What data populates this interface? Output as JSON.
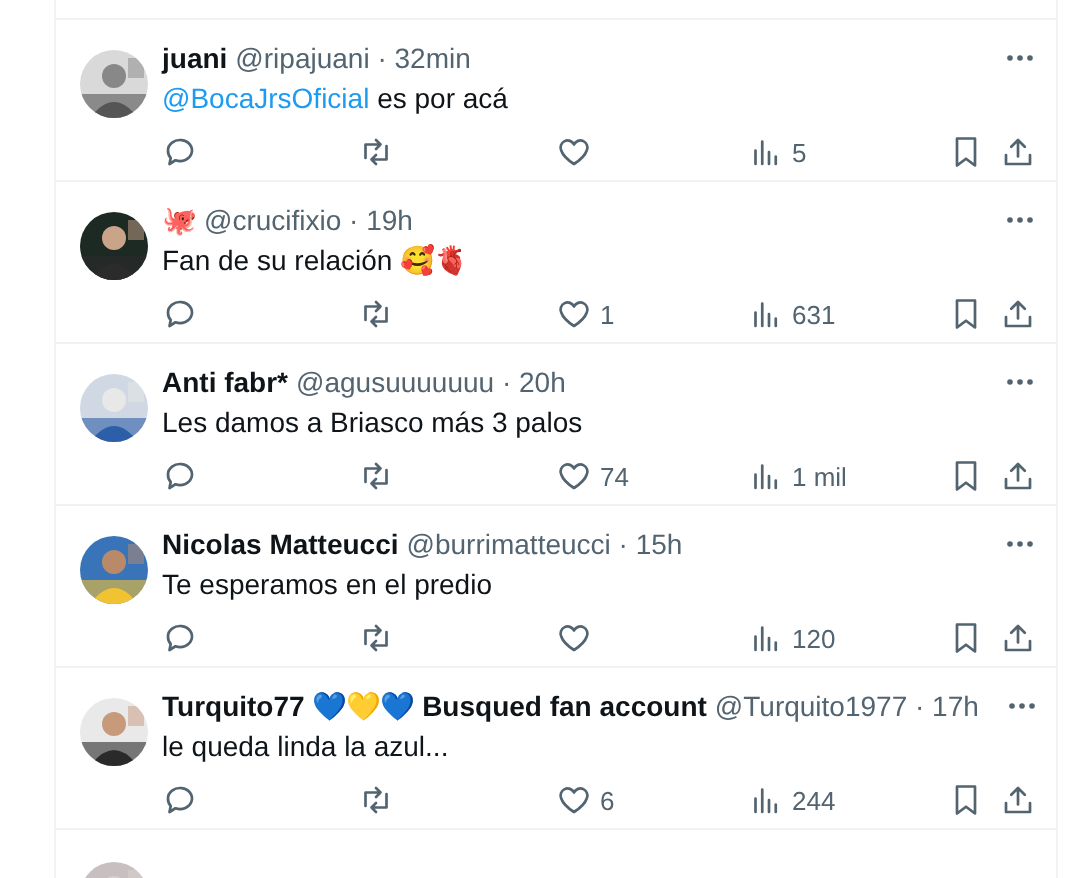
{
  "tweets": [
    {
      "name": "juani",
      "meta": "@ripajuani · 32min",
      "mention": "@BocaJrsOficial",
      "text": "es por acá",
      "stats": {
        "views": "5"
      }
    },
    {
      "name": "🐙",
      "meta": "@crucifixio · 19h",
      "text": "Fan de su relación 🥰🫀",
      "stats": {
        "likes": "1",
        "views": "631"
      }
    },
    {
      "name": "Anti fabr*",
      "meta": "@agusuuuuuuu · 20h",
      "text": "Les damos a Briasco más 3 palos",
      "stats": {
        "likes": "74",
        "views": "1 mil"
      }
    },
    {
      "name": "Nicolas Matteucci",
      "meta": "@burrimatteucci · 15h",
      "text": "Te esperamos en el predio",
      "stats": {
        "views": "120"
      }
    },
    {
      "name": "Turquito77 💙💛💙 Busqued fan account",
      "meta": "@Turquito1977 · 17h",
      "text": "le queda linda la azul...",
      "stats": {
        "likes": "6",
        "views": "244"
      }
    }
  ]
}
